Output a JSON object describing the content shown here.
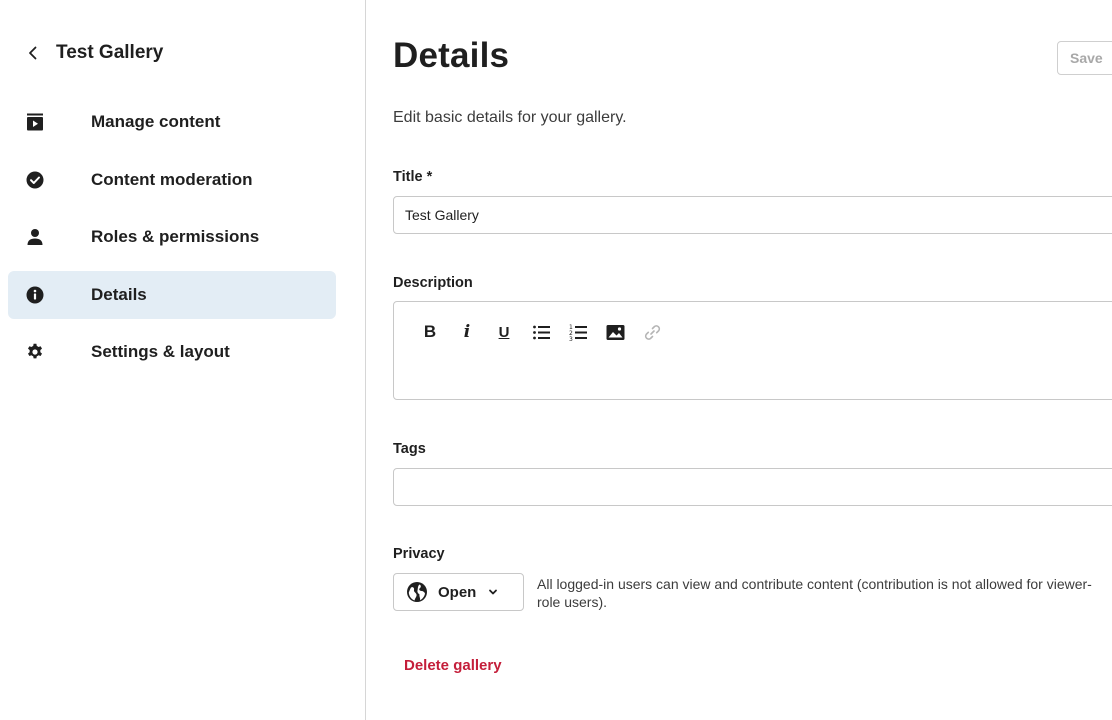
{
  "sidebar": {
    "back_title": "Test Gallery",
    "items": [
      {
        "label": "Manage content",
        "icon": "video-icon"
      },
      {
        "label": "Content moderation",
        "icon": "check-circle-icon"
      },
      {
        "label": "Roles & permissions",
        "icon": "person-icon"
      },
      {
        "label": "Details",
        "icon": "info-icon",
        "active": true
      },
      {
        "label": "Settings & layout",
        "icon": "gear-icon"
      }
    ]
  },
  "main": {
    "title": "Details",
    "save_label": "Save",
    "subtitle": "Edit basic details for your gallery.",
    "title_field": {
      "label": "Title *",
      "value": "Test Gallery"
    },
    "description_field": {
      "label": "Description",
      "toolbar": {
        "bold": "B",
        "italic": "i",
        "underline": "U"
      }
    },
    "tags_field": {
      "label": "Tags",
      "value": ""
    },
    "privacy": {
      "label": "Privacy",
      "value": "Open",
      "help": "All logged-in users can view and contribute content (contribution is not allowed for viewer-role users)."
    },
    "delete_label": "Delete gallery"
  },
  "colors": {
    "active_nav_bg": "#e3edf5",
    "danger": "#c41e3a",
    "text": "#1f1f1f",
    "border": "#c8c8c8"
  }
}
